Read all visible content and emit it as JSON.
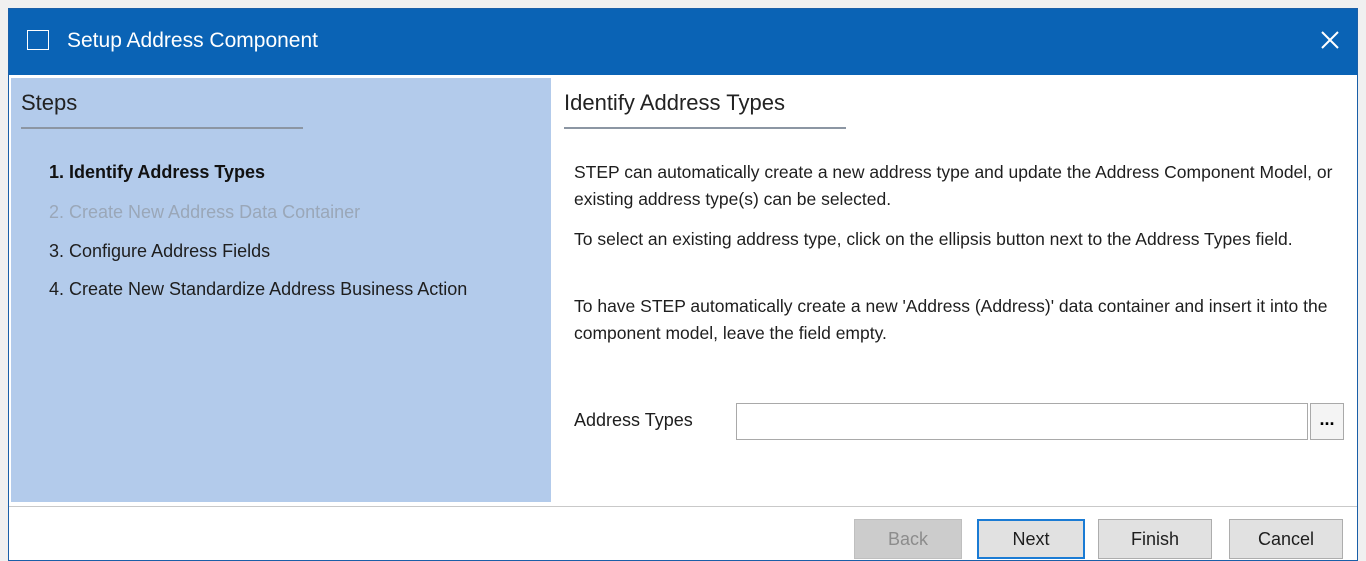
{
  "window": {
    "title": "Setup Address Component"
  },
  "steps": {
    "header": "Steps",
    "items": [
      {
        "label": "1. Identify Address Types",
        "state": "active"
      },
      {
        "label": "2. Create New Address Data Container",
        "state": "disabled"
      },
      {
        "label": "3. Configure Address Fields",
        "state": "normal"
      },
      {
        "label": "4. Create New Standardize Address Business Action",
        "state": "normal"
      }
    ]
  },
  "content": {
    "title": "Identify Address Types",
    "paragraphs": [
      "STEP can automatically create a new address type and update the Address Component Model, or existing address type(s) can be selected.",
      "To select an existing address type, click on the ellipsis button next to the Address Types field.",
      "To have STEP automatically create a new 'Address (Address)' data container and insert it into the component model, leave the field empty."
    ],
    "field_label": "Address Types",
    "field_value": "",
    "ellipsis_label": "..."
  },
  "footer": {
    "back_label": "Back",
    "next_label": "Next",
    "finish_label": "Finish",
    "cancel_label": "Cancel"
  },
  "colors": {
    "titlebar": "#0a63b5",
    "steps_panel": "#b3cbeb",
    "default_button_border": "#1a7bd4"
  }
}
